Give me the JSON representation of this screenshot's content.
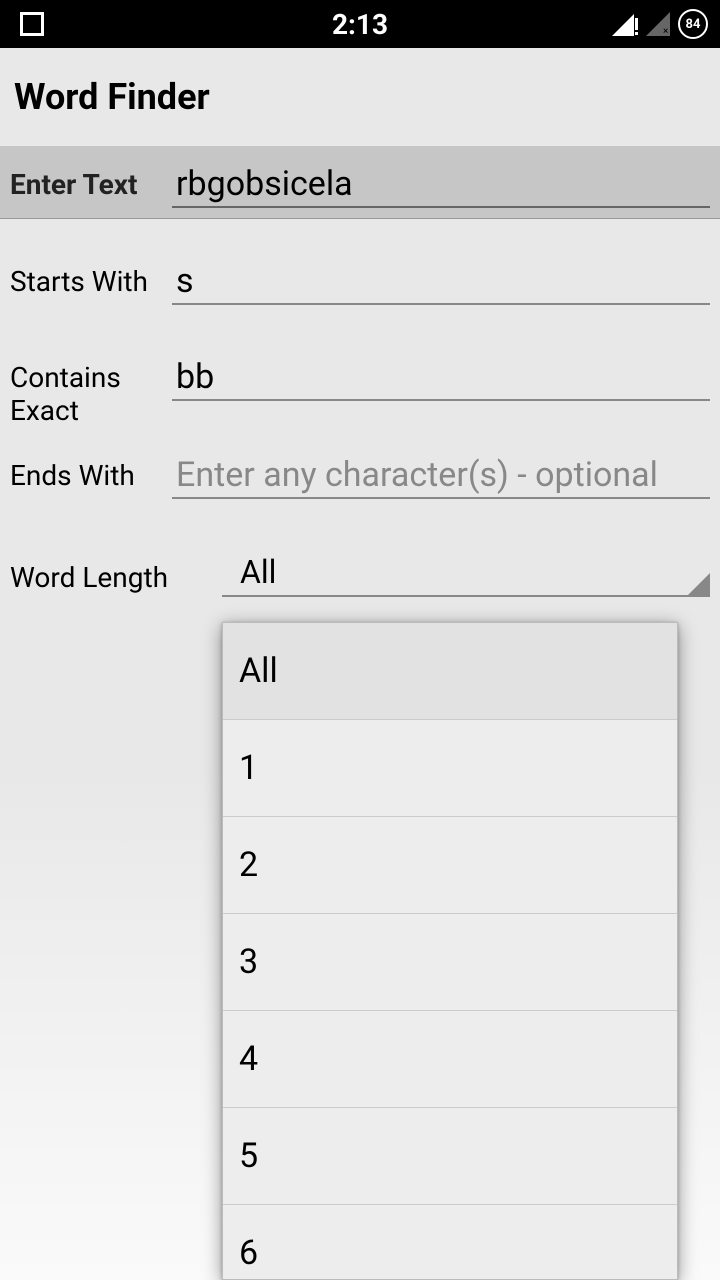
{
  "status": {
    "time": "2:13",
    "battery": "84"
  },
  "header": {
    "title": "Word Finder"
  },
  "form": {
    "enterText": {
      "label": "Enter Text",
      "value": "rbgobsicela"
    },
    "startsWith": {
      "label": "Starts With",
      "value": "s"
    },
    "containsExactL1": "Contains",
    "containsExactL2": "Exact",
    "containsExact": {
      "value": "bb"
    },
    "endsWith": {
      "label": "Ends With",
      "placeholder": "Enter any character(s) - optional",
      "value": ""
    },
    "wordLength": {
      "label": "Word Length",
      "selected": "All"
    }
  },
  "dropdown": {
    "items": [
      "All",
      "1",
      "2",
      "3",
      "4",
      "5",
      "6"
    ]
  }
}
